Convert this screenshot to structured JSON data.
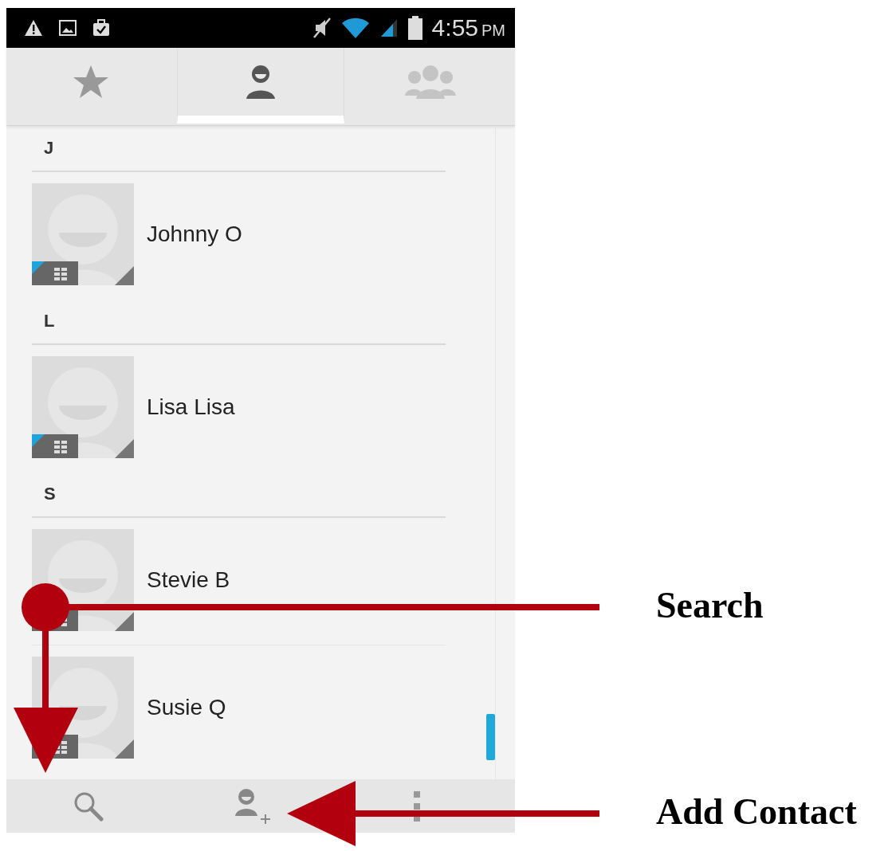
{
  "status_bar": {
    "time": "4:55",
    "ampm": "PM"
  },
  "tabs": [
    {
      "kind": "favorites",
      "selected": false
    },
    {
      "kind": "contacts",
      "selected": true
    },
    {
      "kind": "groups",
      "selected": false
    }
  ],
  "sections": [
    {
      "letter": "J",
      "contacts": [
        {
          "name": "Johnny O"
        }
      ]
    },
    {
      "letter": "L",
      "contacts": [
        {
          "name": "Lisa Lisa"
        }
      ]
    },
    {
      "letter": "S",
      "contacts": [
        {
          "name": "Stevie B"
        },
        {
          "name": "Susie Q"
        }
      ]
    }
  ],
  "action_bar": [
    {
      "kind": "search"
    },
    {
      "kind": "add_contact"
    },
    {
      "kind": "overflow"
    }
  ],
  "callouts": [
    {
      "kind": "down",
      "label": "Search"
    },
    {
      "kind": "left",
      "label": "Add Contact"
    }
  ]
}
